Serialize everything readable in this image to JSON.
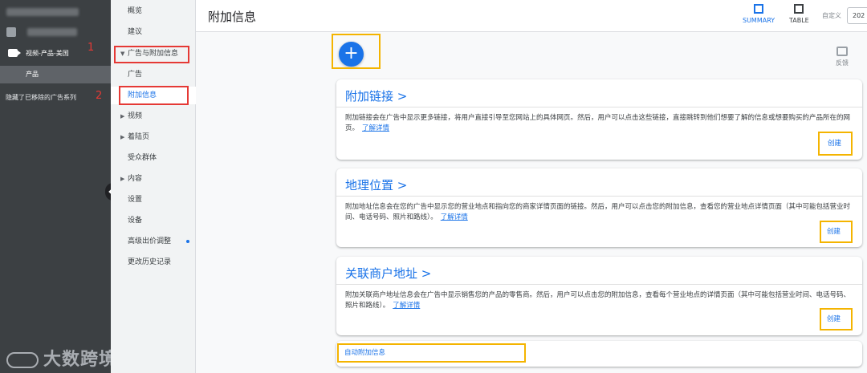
{
  "left_panel": {
    "campaign": "视频-产品-美国",
    "ad_group": "产品",
    "hidden_note": "隐藏了已移除的广告系列"
  },
  "annotations": {
    "step1": "1",
    "step2": "2"
  },
  "nav": {
    "items": [
      {
        "label": "概览"
      },
      {
        "label": "建议"
      },
      {
        "label": "广告与附加信息"
      },
      {
        "label": "广告"
      },
      {
        "label": "附加信息"
      },
      {
        "label": "视频"
      },
      {
        "label": "着陆页"
      },
      {
        "label": "受众群体"
      },
      {
        "label": "内容"
      },
      {
        "label": "设置"
      },
      {
        "label": "设备"
      },
      {
        "label": "高级出价调整"
      },
      {
        "label": "更改历史记录"
      }
    ]
  },
  "header": {
    "title": "附加信息",
    "summary_label": "SUMMARY",
    "table_label": "TABLE",
    "custom_label": "自定义",
    "date_value": "202"
  },
  "feedback_label": "反馈",
  "fab_label": "+",
  "cards": [
    {
      "title": "附加链接 >",
      "desc": "附加链接会在广告中显示更多链接，将用户直接引导至您网站上的具体网页。然后，用户可以点击这些链接，直接跳转到他们想要了解的信息或想要购买的产品所在的网页。",
      "link": "了解详情",
      "create": "创建"
    },
    {
      "title": "地理位置 >",
      "desc": "附加地址信息会在您的广告中显示您的营业地点和指向您的商家详情页面的链接。然后，用户可以点击您的附加信息，查看您的营业地点详情页面（其中可能包括营业时间、电话号码、照片和路线）。",
      "link": "了解详情",
      "create": "创建"
    },
    {
      "title": "关联商户地址 >",
      "desc": "附加关联商户地址信息会在广告中显示销售您的产品的零售商。然后，用户可以点击您的附加信息，查看每个营业地点的详情页面（其中可能包括营业时间、电话号码、照片和路线）。",
      "link": "了解详情",
      "create": "创建"
    }
  ],
  "auto_extensions_label": "自动附加信息",
  "watermark": "大数跨境"
}
